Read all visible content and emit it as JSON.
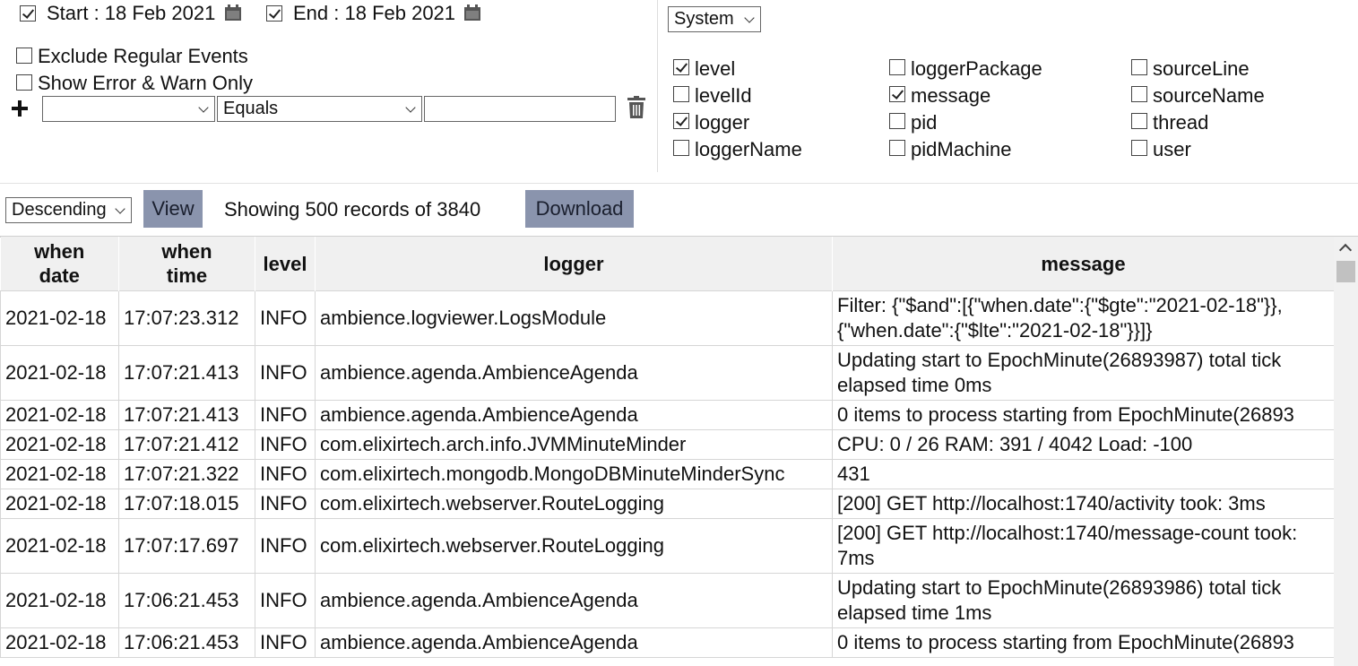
{
  "date_filter": {
    "start_label": "Start : 18 Feb 2021",
    "start_checked": true,
    "end_label": "End : 18 Feb 2021",
    "end_checked": true,
    "calendar_icon": "calendar-icon"
  },
  "filters": {
    "exclude_regular_label": "Exclude Regular Events",
    "exclude_regular_checked": false,
    "error_warn_label": "Show Error & Warn Only",
    "error_warn_checked": false,
    "add_icon": "plus-icon",
    "field_value": "",
    "operator_value": "Equals",
    "match_value": "",
    "delete_icon": "trash-icon"
  },
  "columns_panel": {
    "source_select": "System",
    "items": [
      {
        "label": "level",
        "checked": true
      },
      {
        "label": "levelId",
        "checked": false
      },
      {
        "label": "logger",
        "checked": true
      },
      {
        "label": "loggerName",
        "checked": false
      },
      {
        "label": "loggerPackage",
        "checked": false
      },
      {
        "label": "message",
        "checked": true
      },
      {
        "label": "pid",
        "checked": false
      },
      {
        "label": "pidMachine",
        "checked": false
      },
      {
        "label": "sourceLine",
        "checked": false
      },
      {
        "label": "sourceName",
        "checked": false
      },
      {
        "label": "thread",
        "checked": false
      },
      {
        "label": "user",
        "checked": false
      }
    ]
  },
  "toolbar": {
    "order_select": "Descending",
    "view_label": "View",
    "status_text": "Showing 500 records of 3840",
    "download_label": "Download",
    "button_color": "#8a94ad"
  },
  "table": {
    "headers": [
      {
        "line1": "when",
        "line2": "date"
      },
      {
        "line1": "when",
        "line2": "time"
      },
      {
        "line1": "level",
        "line2": ""
      },
      {
        "line1": "logger",
        "line2": ""
      },
      {
        "line1": "message",
        "line2": ""
      }
    ],
    "rows": [
      {
        "date": "2021-02-18",
        "time": "17:07:23.312",
        "level": "INFO",
        "logger": "ambience.logviewer.LogsModule",
        "message": "Filter: {\"$and\":[{\"when.date\":{\"$gte\":\"2021-02-18\"}}, {\"when.date\":{\"$lte\":\"2021-02-18\"}}]}"
      },
      {
        "date": "2021-02-18",
        "time": "17:07:21.413",
        "level": "INFO",
        "logger": "ambience.agenda.AmbienceAgenda",
        "message": "Updating start to EpochMinute(26893987) total tick elapsed time 0ms"
      },
      {
        "date": "2021-02-18",
        "time": "17:07:21.413",
        "level": "INFO",
        "logger": "ambience.agenda.AmbienceAgenda",
        "message": "0 items to process starting from EpochMinute(26893"
      },
      {
        "date": "2021-02-18",
        "time": "17:07:21.412",
        "level": "INFO",
        "logger": "com.elixirtech.arch.info.JVMMinuteMinder",
        "message": "CPU: 0 / 26 RAM: 391 / 4042 Load: -100"
      },
      {
        "date": "2021-02-18",
        "time": "17:07:21.322",
        "level": "INFO",
        "logger": "com.elixirtech.mongodb.MongoDBMinuteMinderSync",
        "message": "431"
      },
      {
        "date": "2021-02-18",
        "time": "17:07:18.015",
        "level": "INFO",
        "logger": "com.elixirtech.webserver.RouteLogging",
        "message": "[200] GET http://localhost:1740/activity took: 3ms"
      },
      {
        "date": "2021-02-18",
        "time": "17:07:17.697",
        "level": "INFO",
        "logger": "com.elixirtech.webserver.RouteLogging",
        "message": "[200] GET http://localhost:1740/message-count took: 7ms"
      },
      {
        "date": "2021-02-18",
        "time": "17:06:21.453",
        "level": "INFO",
        "logger": "ambience.agenda.AmbienceAgenda",
        "message": "Updating start to EpochMinute(26893986) total tick elapsed time 1ms"
      },
      {
        "date": "2021-02-18",
        "time": "17:06:21.453",
        "level": "INFO",
        "logger": "ambience.agenda.AmbienceAgenda",
        "message": "0 items to process starting from EpochMinute(26893"
      }
    ]
  }
}
